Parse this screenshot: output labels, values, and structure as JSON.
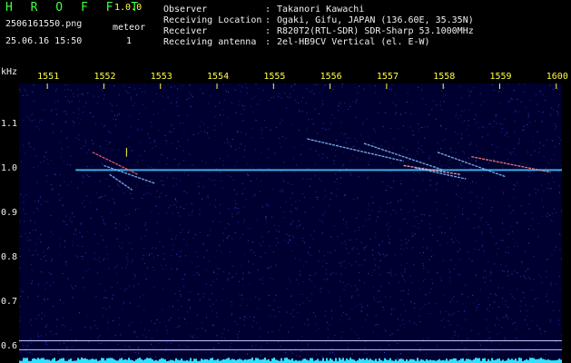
{
  "header": {
    "logo": "H R O F F T",
    "version": "1.0.0",
    "filename": "2506161550.png",
    "meteor_label": "meteor",
    "timestamp": "25.06.16 15:50",
    "meteor_count": "1"
  },
  "info": [
    {
      "label": "Observer",
      "value": "Takanori Kawachi"
    },
    {
      "label": "Receiving Location",
      "value": "Ogaki, Gifu, JAPAN (136.60E, 35.35N)"
    },
    {
      "label": "Receiver",
      "value": "R820T2(RTL-SDR) SDR-Sharp 53.1000MHz"
    },
    {
      "label": "Receiving antenna",
      "value": "2el-HB9CV Vertical (el. E-W)"
    }
  ],
  "info_separator": ":",
  "spectrogram": {
    "y_unit": "kHz",
    "x_ticks": [
      "1551",
      "1552",
      "1553",
      "1554",
      "1555",
      "1556",
      "1557",
      "1558",
      "1559",
      "1600"
    ],
    "y_ticks": [
      "1.1",
      "1.0",
      "0.9",
      "0.8",
      "0.7",
      "0.6"
    ],
    "y_tick_values": [
      1.1,
      1.0,
      0.9,
      0.8,
      0.7,
      0.6
    ],
    "y_range": [
      0.565,
      1.195
    ],
    "x_range": [
      0,
      9.6
    ],
    "carrier_khz": 1.0,
    "colors": {
      "background": "#000033",
      "signal": "#40c0ff",
      "marker": "#ffff40",
      "text": "#40ff40"
    }
  }
}
